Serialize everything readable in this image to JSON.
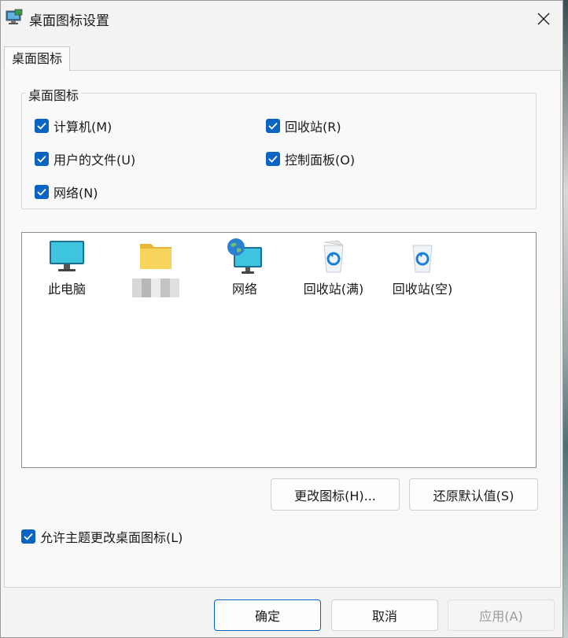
{
  "window": {
    "title": "桌面图标设置"
  },
  "tabs": [
    {
      "label": "桌面图标"
    }
  ],
  "group": {
    "legend": "桌面图标",
    "checkboxes": [
      {
        "label": "计算机(M)",
        "checked": true
      },
      {
        "label": "回收站(R)",
        "checked": true
      },
      {
        "label": "用户的文件(U)",
        "checked": true
      },
      {
        "label": "控制面板(O)",
        "checked": true
      },
      {
        "label": "网络(N)",
        "checked": true
      }
    ]
  },
  "icons": [
    {
      "label": "此电脑",
      "icon": "monitor-icon"
    },
    {
      "label": "",
      "icon": "folder-icon",
      "blurred": true
    },
    {
      "label": "网络",
      "icon": "network-globe-icon"
    },
    {
      "label": "回收站(满)",
      "icon": "recycle-bin-full-icon"
    },
    {
      "label": "回收站(空)",
      "icon": "recycle-bin-empty-icon"
    }
  ],
  "icon_buttons": {
    "change": "更改图标(H)...",
    "restore": "还原默认值(S)"
  },
  "theme_checkbox": {
    "label": "允许主题更改桌面图标(L)",
    "checked": true
  },
  "footer": {
    "ok": "确定",
    "cancel": "取消",
    "apply": "应用(A)"
  },
  "colors": {
    "accent": "#0a64c2",
    "dialog_bg": "#f3f3f3",
    "list_bg": "#ffffff"
  }
}
